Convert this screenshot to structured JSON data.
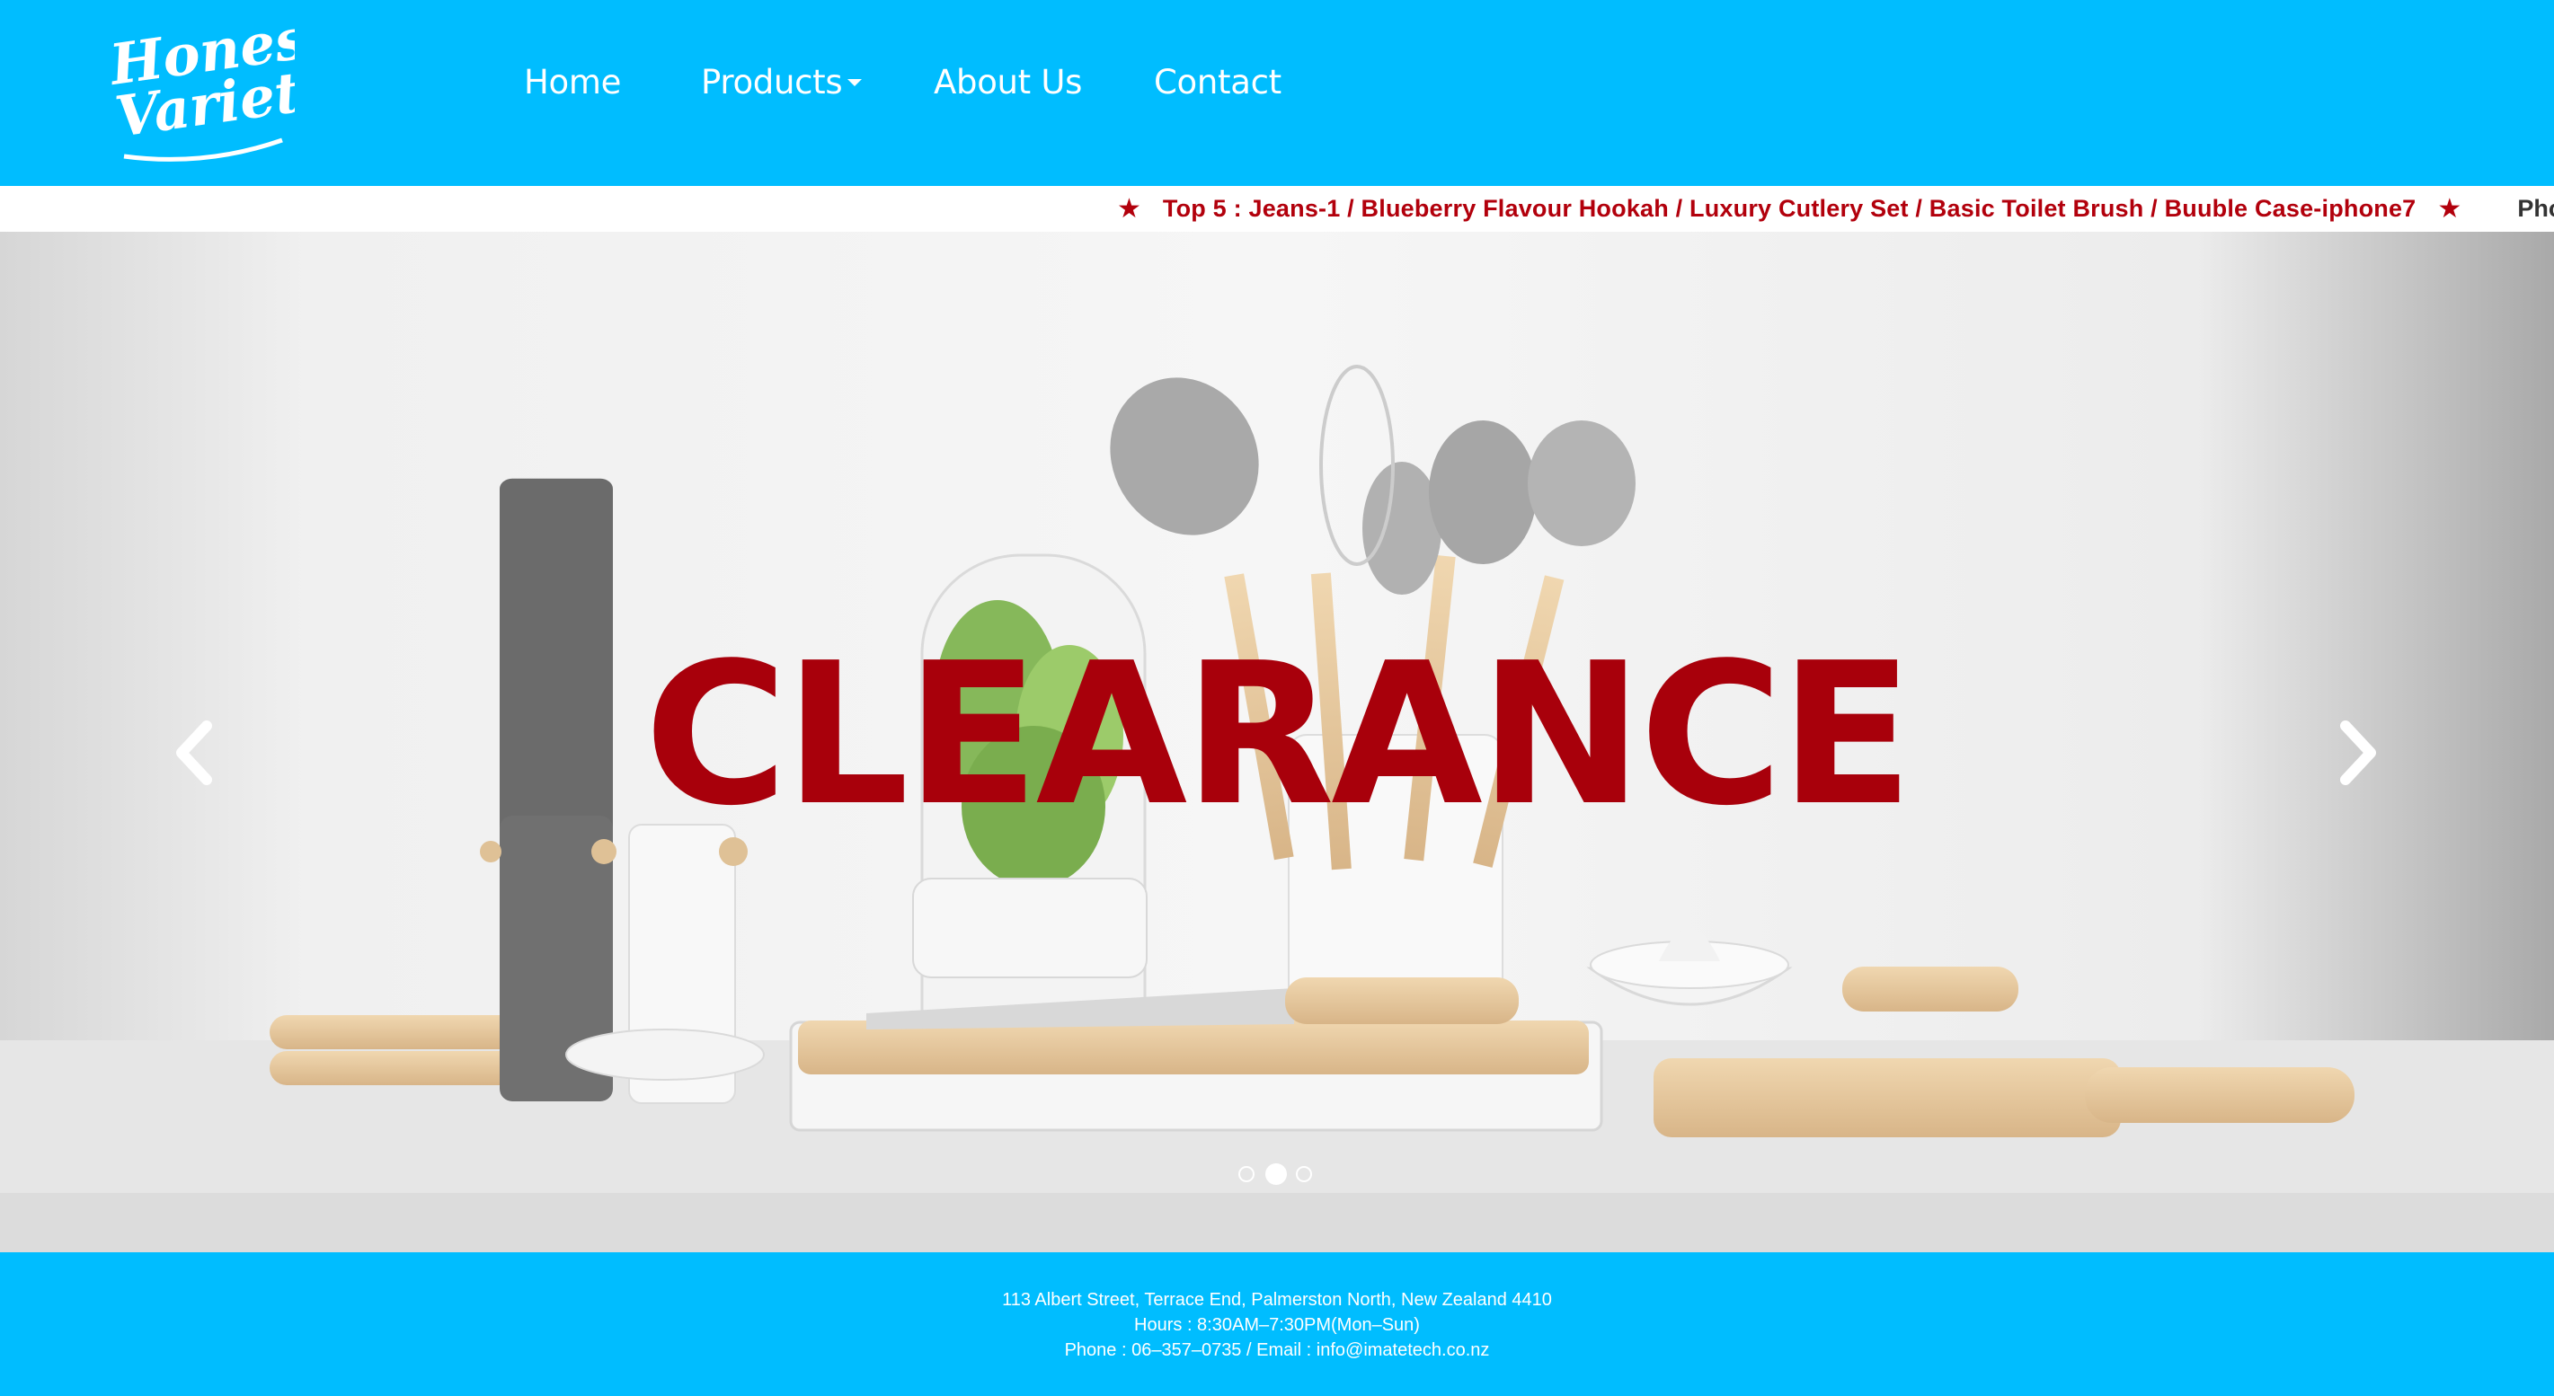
{
  "brand": {
    "logo_line1": "Honest",
    "logo_line2": "Variety",
    "primary_color": "#00bdff",
    "accent_color": "#a8000b"
  },
  "nav": {
    "home": "Home",
    "products": "Products",
    "about": "About Us",
    "contact": "Contact"
  },
  "ticker": {
    "star": "★",
    "text": "Top 5 : Jeans-1 / Blueberry Flavour Hookah / Luxury Cutlery Set / Basic Toilet Brush / Buuble Case-iphone7",
    "next_text": "Phone"
  },
  "carousel": {
    "headline": "CLEARANCE",
    "prev_icon": "chevron-left-icon",
    "next_icon": "chevron-right-icon",
    "slide_count": 3,
    "active_slide": 2
  },
  "footer": {
    "address": "113 Albert Street, Terrace End, Palmerston North, New Zealand 4410",
    "hours": "Hours : 8:30AM–7:30PM(Mon–Sun)",
    "contact": "Phone : 06–357–0735 / Email : info@imatetech.co.nz"
  }
}
